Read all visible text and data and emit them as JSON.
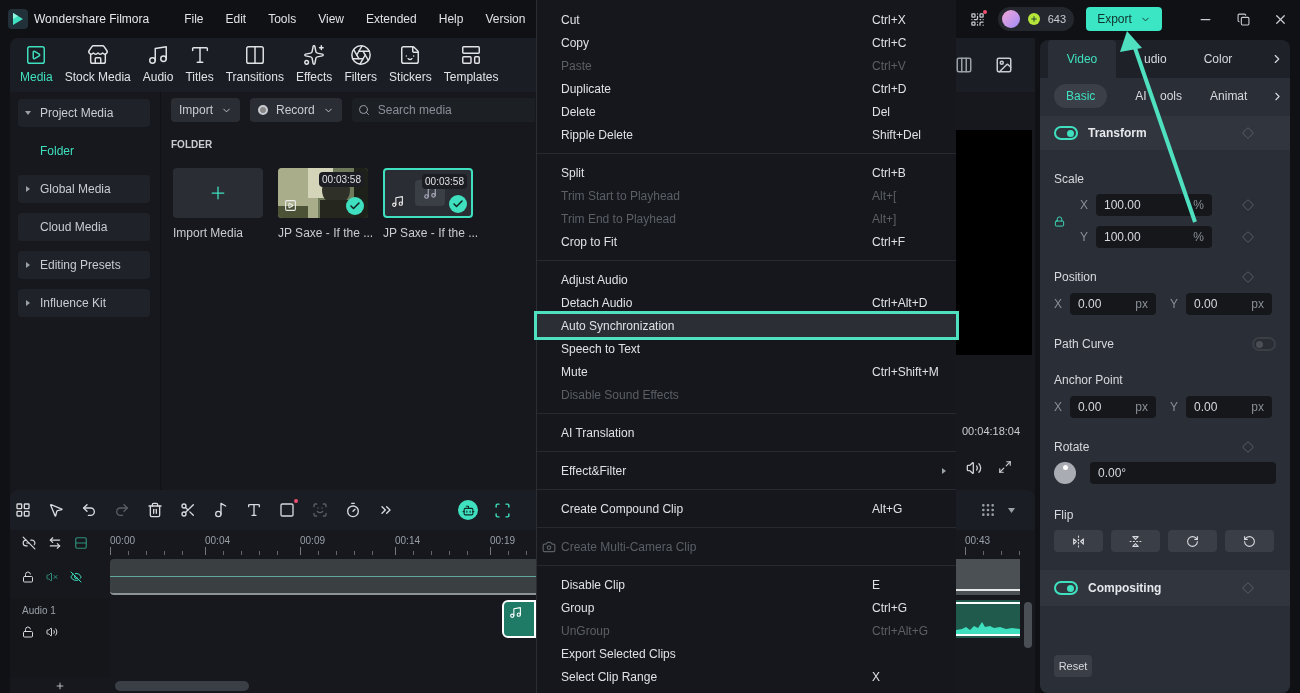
{
  "app": {
    "name": "Wondershare Filmora"
  },
  "menubar": [
    "File",
    "Edit",
    "Tools",
    "View",
    "Extended",
    "Help",
    "Version"
  ],
  "credits": "643",
  "export_button": "Export",
  "nav_tabs": [
    {
      "label": "Media",
      "selected": true
    },
    {
      "label": "Stock Media",
      "selected": false
    },
    {
      "label": "Audio",
      "selected": false
    },
    {
      "label": "Titles",
      "selected": false
    },
    {
      "label": "Transitions",
      "selected": false
    },
    {
      "label": "Effects",
      "selected": false
    },
    {
      "label": "Filters",
      "selected": false
    },
    {
      "label": "Stickers",
      "selected": false
    },
    {
      "label": "Templates",
      "selected": false
    }
  ],
  "media_sidebar": [
    {
      "label": "Project Media",
      "expanded": true,
      "children": [
        {
          "label": "Folder",
          "selected": true
        }
      ]
    },
    {
      "label": "Global Media",
      "expanded": false
    },
    {
      "label": "Cloud Media"
    },
    {
      "label": "Editing Presets",
      "expanded": false
    },
    {
      "label": "Influence Kit",
      "expanded": false
    }
  ],
  "media_toolbar": {
    "import": "Import",
    "record": "Record",
    "search_placeholder": "Search media"
  },
  "folder_heading": "FOLDER",
  "media_items": [
    {
      "kind": "import",
      "label": "Import Media"
    },
    {
      "kind": "video",
      "label": "JP Saxe - If the ...",
      "duration": "00:03:58",
      "selected": false,
      "checked": true
    },
    {
      "kind": "audio",
      "label": "JP Saxe - If the ...",
      "duration": "00:03:58",
      "selected": true,
      "checked": true
    }
  ],
  "preview": {
    "timecode": "00:04:18:04"
  },
  "context_menu": {
    "groups": [
      [
        {
          "label": "Cut",
          "shortcut": "Ctrl+X",
          "disabled": false,
          "selected": false
        },
        {
          "label": "Copy",
          "shortcut": "Ctrl+C",
          "disabled": false,
          "selected": false
        },
        {
          "label": "Paste",
          "shortcut": "Ctrl+V",
          "disabled": true,
          "selected": false
        },
        {
          "label": "Duplicate",
          "shortcut": "Ctrl+D",
          "disabled": false,
          "selected": false
        },
        {
          "label": "Delete",
          "shortcut": "Del",
          "disabled": false,
          "selected": false
        },
        {
          "label": "Ripple Delete",
          "shortcut": "Shift+Del",
          "disabled": false,
          "selected": false
        }
      ],
      [
        {
          "label": "Split",
          "shortcut": "Ctrl+B",
          "disabled": false,
          "selected": false
        },
        {
          "label": "Trim Start to Playhead",
          "shortcut": "Alt+[",
          "disabled": true,
          "selected": false
        },
        {
          "label": "Trim End to Playhead",
          "shortcut": "Alt+]",
          "disabled": true,
          "selected": false
        },
        {
          "label": "Crop to Fit",
          "shortcut": "Ctrl+F",
          "disabled": false,
          "selected": false
        }
      ],
      [
        {
          "label": "Adjust Audio",
          "disabled": false,
          "selected": false
        },
        {
          "label": "Detach Audio",
          "shortcut": "Ctrl+Alt+D",
          "disabled": false,
          "selected": false
        },
        {
          "label": "Auto Synchronization",
          "disabled": false,
          "selected": true
        },
        {
          "label": "Speech to Text",
          "disabled": false,
          "selected": false
        },
        {
          "label": "Mute",
          "shortcut": "Ctrl+Shift+M",
          "disabled": false,
          "selected": false
        },
        {
          "label": "Disable Sound Effects",
          "disabled": true,
          "selected": false
        }
      ],
      [
        {
          "label": "AI Translation",
          "disabled": false,
          "selected": false
        }
      ],
      [
        {
          "label": "Effect&Filter",
          "disabled": false,
          "selected": false,
          "submenu": true
        }
      ],
      [
        {
          "label": "Create Compound Clip",
          "shortcut": "Alt+G",
          "disabled": false,
          "selected": false
        }
      ],
      [
        {
          "label": "Create Multi-Camera Clip",
          "disabled": true,
          "selected": false,
          "has_icon": true
        }
      ],
      [
        {
          "label": "Disable Clip",
          "shortcut": "E",
          "disabled": false,
          "selected": false
        },
        {
          "label": "Group",
          "shortcut": "Ctrl+G",
          "disabled": false,
          "selected": false
        },
        {
          "label": "UnGroup",
          "shortcut": "Ctrl+Alt+G",
          "disabled": true,
          "selected": false
        },
        {
          "label": "Export Selected Clips",
          "disabled": false,
          "selected": false
        },
        {
          "label": "Select Clip Range",
          "shortcut": "X",
          "disabled": false,
          "selected": false
        }
      ]
    ]
  },
  "timeline": {
    "ruler_left": [
      "00:00",
      "00:04",
      "00:09",
      "00:14",
      "00:19"
    ],
    "ruler_right": [
      "00:43"
    ],
    "audio_track": "Audio 1"
  },
  "properties": {
    "tabs": [
      {
        "label": "Video",
        "selected": true
      },
      {
        "label": "udio",
        "selected": false
      },
      {
        "label": "Color",
        "selected": false
      }
    ],
    "subtabs": [
      {
        "label": "Basic",
        "selected": true
      },
      {
        "label": "AI ools",
        "selected": false
      },
      {
        "label": "Animat",
        "selected": false
      }
    ],
    "transform": {
      "title": "Transform",
      "on": true
    },
    "scale": {
      "label": "Scale",
      "x": {
        "axis": "X",
        "value": "100.00",
        "unit": "%"
      },
      "y": {
        "axis": "Y",
        "value": "100.00",
        "unit": "%"
      }
    },
    "position": {
      "label": "Position",
      "x": {
        "axis": "X",
        "value": "0.00",
        "unit": "px"
      },
      "y": {
        "axis": "Y",
        "value": "0.00",
        "unit": "px"
      }
    },
    "path_curve": {
      "label": "Path Curve",
      "on": false
    },
    "anchor_point": {
      "label": "Anchor Point",
      "x": {
        "axis": "X",
        "value": "0.00",
        "unit": "px"
      },
      "y": {
        "axis": "Y",
        "value": "0.00",
        "unit": "px"
      }
    },
    "rotate": {
      "label": "Rotate",
      "value": "0.00°"
    },
    "flip": {
      "label": "Flip"
    },
    "compositing": {
      "title": "Compositing",
      "on": true
    },
    "reset_button": "Reset"
  }
}
